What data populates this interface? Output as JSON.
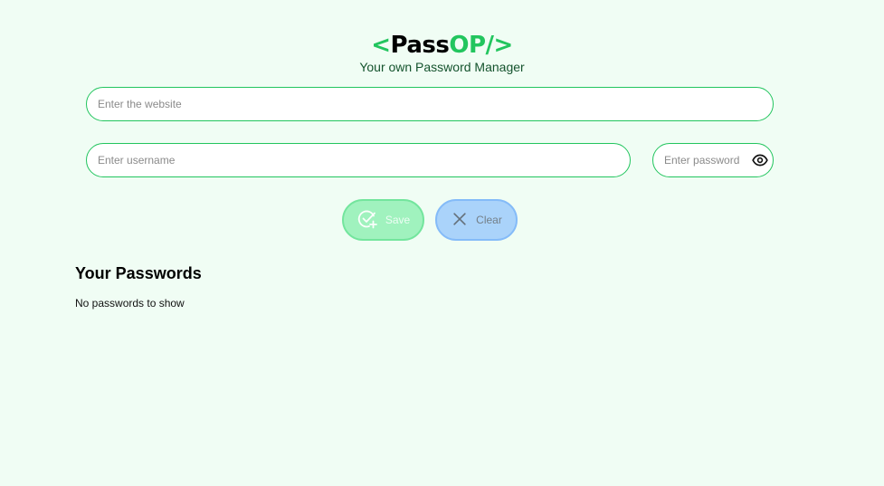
{
  "header": {
    "logo_open": "<",
    "logo_pass": "Pass",
    "logo_op": "OP",
    "logo_close": "/>",
    "tagline": "Your own Password Manager"
  },
  "form": {
    "website_placeholder": "Enter the website",
    "username_placeholder": "Enter username",
    "password_placeholder": "Enter password",
    "show_password_icon": "eye-icon",
    "save_label": "Save",
    "save_icon": "check-add-icon",
    "clear_label": "Clear",
    "clear_icon": "close-icon"
  },
  "passwords": {
    "title": "Your Passwords",
    "empty_text": "No passwords to show"
  },
  "colors": {
    "background": "#f0fdf4",
    "accent": "#22c55e",
    "save_button": "#86efac",
    "clear_button": "#93c5fd"
  }
}
